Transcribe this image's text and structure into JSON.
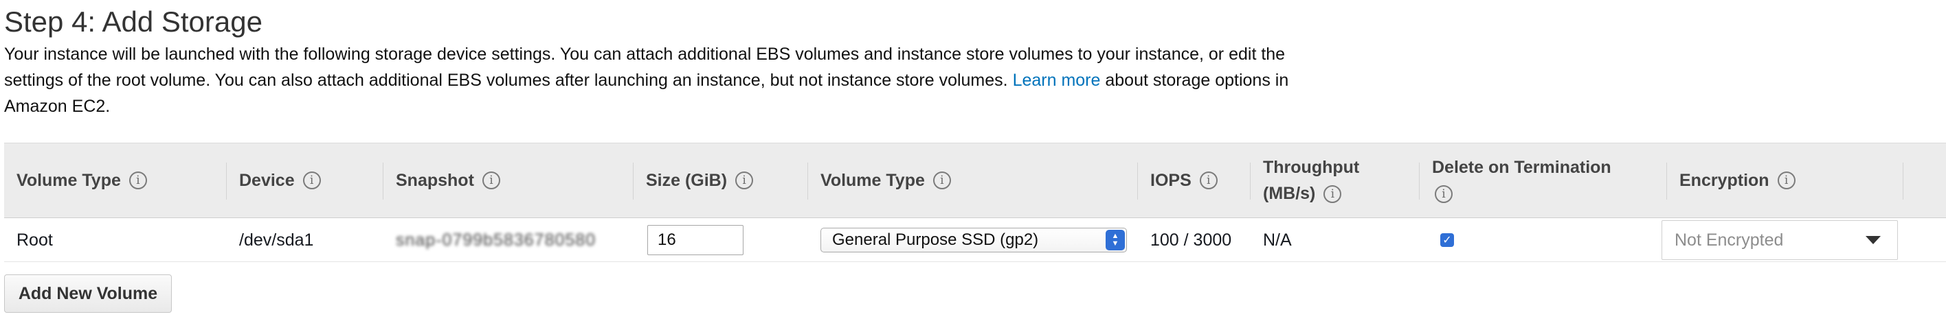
{
  "page": {
    "title": "Step 4: Add Storage",
    "description_before_link": "Your instance will be launched with the following storage device settings. You can attach additional EBS volumes and instance store volumes to your instance, or edit the settings of the root volume. You can also attach additional EBS volumes after launching an instance, but not instance store volumes.",
    "learn_more_link": "Learn more",
    "description_after_link": "about storage options in Amazon EC2."
  },
  "table": {
    "headers": {
      "volume_type": "Volume Type",
      "device": "Device",
      "snapshot": "Snapshot",
      "size": "Size (GiB)",
      "volume_type_2": "Volume Type",
      "iops": "IOPS",
      "throughput_line1": "Throughput",
      "throughput_line2": "(MB/s)",
      "delete_on_termination": "Delete on Termination",
      "encryption": "Encryption"
    },
    "info_glyph": "i",
    "rows": [
      {
        "volume_type": "Root",
        "device": "/dev/sda1",
        "snapshot": "snap-0799b5836780580",
        "size": "16",
        "ebs_volume_type": "General Purpose SSD (gp2)",
        "iops": "100 / 3000",
        "throughput": "N/A",
        "delete_on_termination": true,
        "encryption": "Not Encrypted"
      }
    ]
  },
  "buttons": {
    "add_new_volume": "Add New Volume"
  },
  "colors": {
    "link": "#0073bb",
    "header_bg": "#ececec",
    "accent_blue": "#2f6fd6"
  },
  "icons": {
    "info": "info-icon",
    "stepper": "select-stepper-icon",
    "caret": "caret-down-icon",
    "check": "checkmark-icon"
  }
}
